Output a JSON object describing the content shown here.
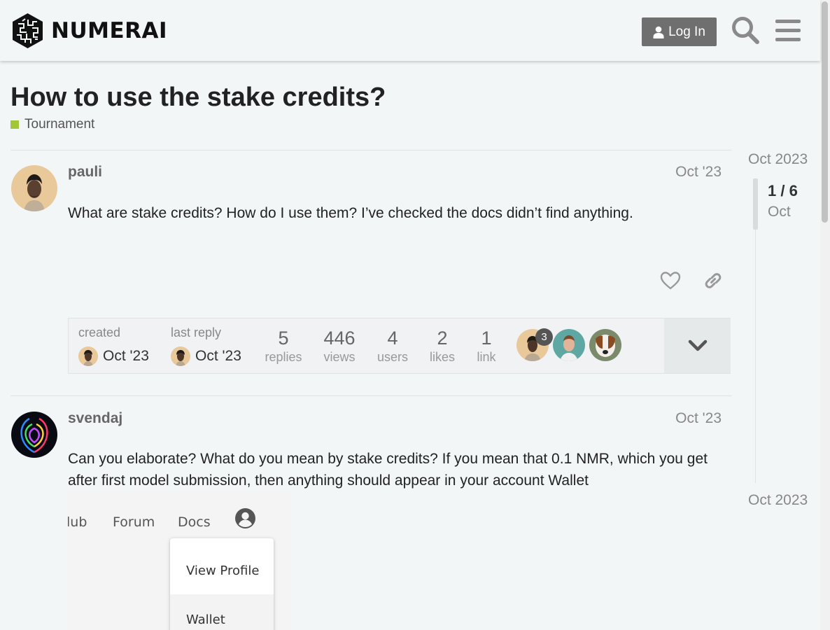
{
  "header": {
    "brand": "NUMERAI",
    "login_label": "Log In"
  },
  "topic": {
    "title": "How to use the stake credits?",
    "category": "Tournament",
    "category_color": "#a1c638"
  },
  "posts": [
    {
      "username": "pauli",
      "date": "Oct '23",
      "body": "What are stake credits? How do I use them? I’ve checked the docs didn’t find anything."
    },
    {
      "username": "svendaj",
      "date": "Oct '23",
      "body": "Can you elaborate? What do you mean by stake credits? If you mean that 0.1 NMR, which you get after first model submission, then anything should appear in your account Wallet"
    }
  ],
  "topic_map": {
    "created_label": "created",
    "created_date": "Oct '23",
    "last_reply_label": "last reply",
    "last_reply_date": "Oct '23",
    "stats": [
      {
        "value": "5",
        "label": "replies"
      },
      {
        "value": "446",
        "label": "views"
      },
      {
        "value": "4",
        "label": "users"
      },
      {
        "value": "2",
        "label": "likes"
      },
      {
        "value": "1",
        "label": "link"
      }
    ],
    "participant_badge": "3"
  },
  "timeline": {
    "top_label": "Oct 2023",
    "position": "1 / 6",
    "position_sub": "Oct",
    "bottom_label": "Oct 2023"
  },
  "embedded_image": {
    "nav_items": [
      "lub",
      "Forum",
      "Docs"
    ],
    "menu_items": [
      "View Profile",
      "Wallet"
    ]
  }
}
